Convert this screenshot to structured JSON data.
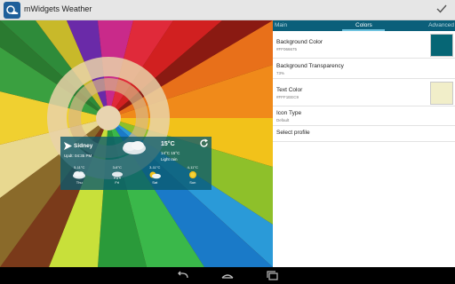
{
  "app": {
    "title": "mWidgets Weather"
  },
  "widget": {
    "city": "Sidney",
    "updated": "Updt: 04:35 PM",
    "temp": "15°C",
    "range": "14°C  15°C",
    "condition": "Light rain",
    "forecast": [
      {
        "range": "5-11°C",
        "day": "Thu",
        "icon": "cloud-icon"
      },
      {
        "range": "3-6°C",
        "day": "Fri",
        "icon": "snow-cloud-icon"
      },
      {
        "range": "3-11°C",
        "day": "Sat",
        "icon": "partly-cloudy-icon"
      },
      {
        "range": "4-11°C",
        "day": "Sun",
        "icon": "sun-icon"
      }
    ]
  },
  "tabs": {
    "main": "Main",
    "colors": "Colors",
    "advanced": "Advanced"
  },
  "settings": {
    "bg_color_title": "Background Color",
    "bg_color_value": "#FF066675",
    "bg_transparency_title": "Background Transparency",
    "bg_transparency_value": "73%",
    "text_color_title": "Text Color",
    "text_color_value": "#FFF1EEC9",
    "icon_type_title": "Icon Type",
    "icon_type_value": "Default",
    "select_profile_title": "Select profile"
  },
  "colors": {
    "background_swatch": "#066675",
    "text_swatch": "#F1EEC9",
    "tab_bar": "#0B5F7A"
  }
}
